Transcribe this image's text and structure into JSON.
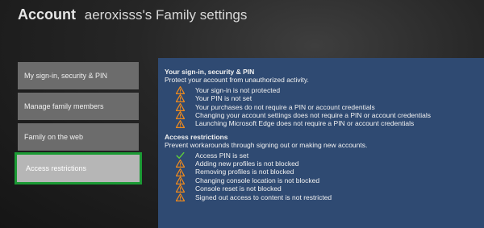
{
  "header": {
    "title_strong": "Account",
    "title_rest": "aeroxisss's Family settings"
  },
  "sidebar": {
    "items": [
      {
        "label": "My sign-in, security & PIN"
      },
      {
        "label": "Manage family members"
      },
      {
        "label": "Family on the web"
      },
      {
        "label": "Access restrictions"
      }
    ]
  },
  "panel": {
    "section1": {
      "title": "Your sign-in, security & PIN",
      "subtitle": "Protect your account from unauthorized activity.",
      "items": [
        {
          "icon": "warning-icon",
          "text": "Your sign-in is not protected"
        },
        {
          "icon": "warning-icon",
          "text": "Your PIN is not set"
        },
        {
          "icon": "warning-icon",
          "text": "Your purchases do not require a PIN or account credentials"
        },
        {
          "icon": "warning-icon",
          "text": "Changing your account settings does not require a PIN or account credentials"
        },
        {
          "icon": "warning-icon",
          "text": "Launching Microsoft Edge does not require a PIN or account credentials"
        }
      ]
    },
    "section2": {
      "title": "Access restrictions",
      "subtitle": "Prevent workarounds through signing out or making new accounts.",
      "items": [
        {
          "icon": "checkmark-icon",
          "text": "Access PIN is set"
        },
        {
          "icon": "warning-icon",
          "text": "Adding new profiles is not blocked"
        },
        {
          "icon": "warning-icon",
          "text": "Removing profiles is not blocked"
        },
        {
          "icon": "warning-icon",
          "text": "Changing console location is not blocked"
        },
        {
          "icon": "warning-icon",
          "text": "Console reset is not blocked"
        },
        {
          "icon": "warning-icon",
          "text": "Signed out access to content is not restricted"
        }
      ]
    }
  },
  "colors": {
    "panel_bg": "#2f4a72",
    "warning": "#f08a1c",
    "check": "#5fcf3a",
    "selection_border": "#1b9a34"
  }
}
